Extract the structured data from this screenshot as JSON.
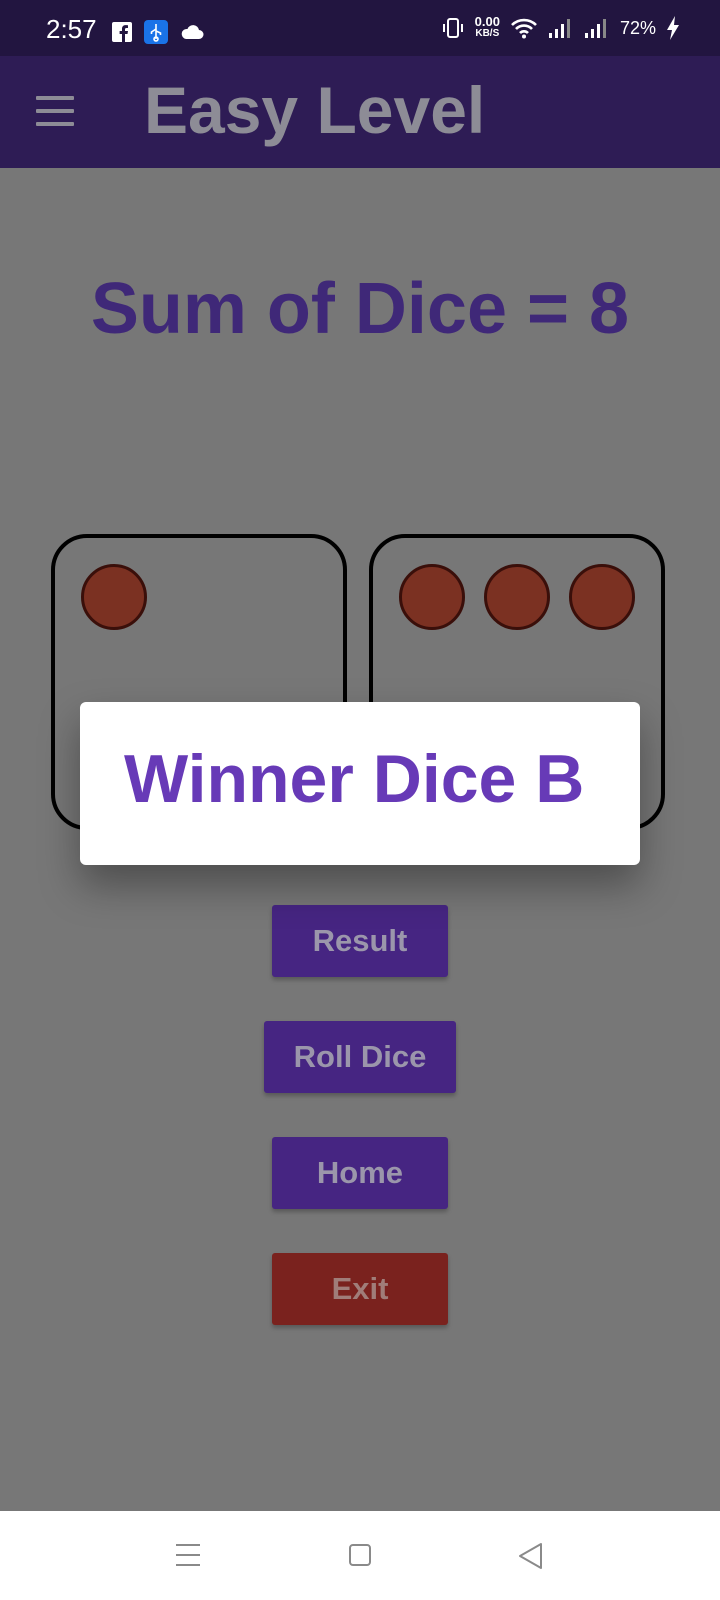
{
  "status_bar": {
    "time": "2:57",
    "net_speed_value": "0.00",
    "net_speed_unit": "KB/S",
    "battery": "72%",
    "icons": [
      "facebook-icon",
      "usb-icon",
      "cloud-icon",
      "vibrate-icon",
      "wifi-icon",
      "signal-icon",
      "signal-icon",
      "charging-icon"
    ]
  },
  "app_bar": {
    "title": "Easy Level",
    "menu_icon": "hamburger-menu-icon"
  },
  "game": {
    "sum_text": "Sum of Dice = 8",
    "dice_a_pips": 1,
    "dice_b_pips": 3,
    "pip_color": "#7b3122"
  },
  "buttons": {
    "result": "Result",
    "roll_dice": "Roll Dice",
    "home": "Home",
    "exit": "Exit"
  },
  "dialog": {
    "message": "Winner Dice B"
  },
  "nav_bar": {
    "icons": [
      "recent-apps-icon",
      "home-icon",
      "back-icon"
    ]
  },
  "colors": {
    "primary": "#462582",
    "accent_text": "#673ab7",
    "exit": "#7a221e",
    "scrim_background": "#777777"
  }
}
